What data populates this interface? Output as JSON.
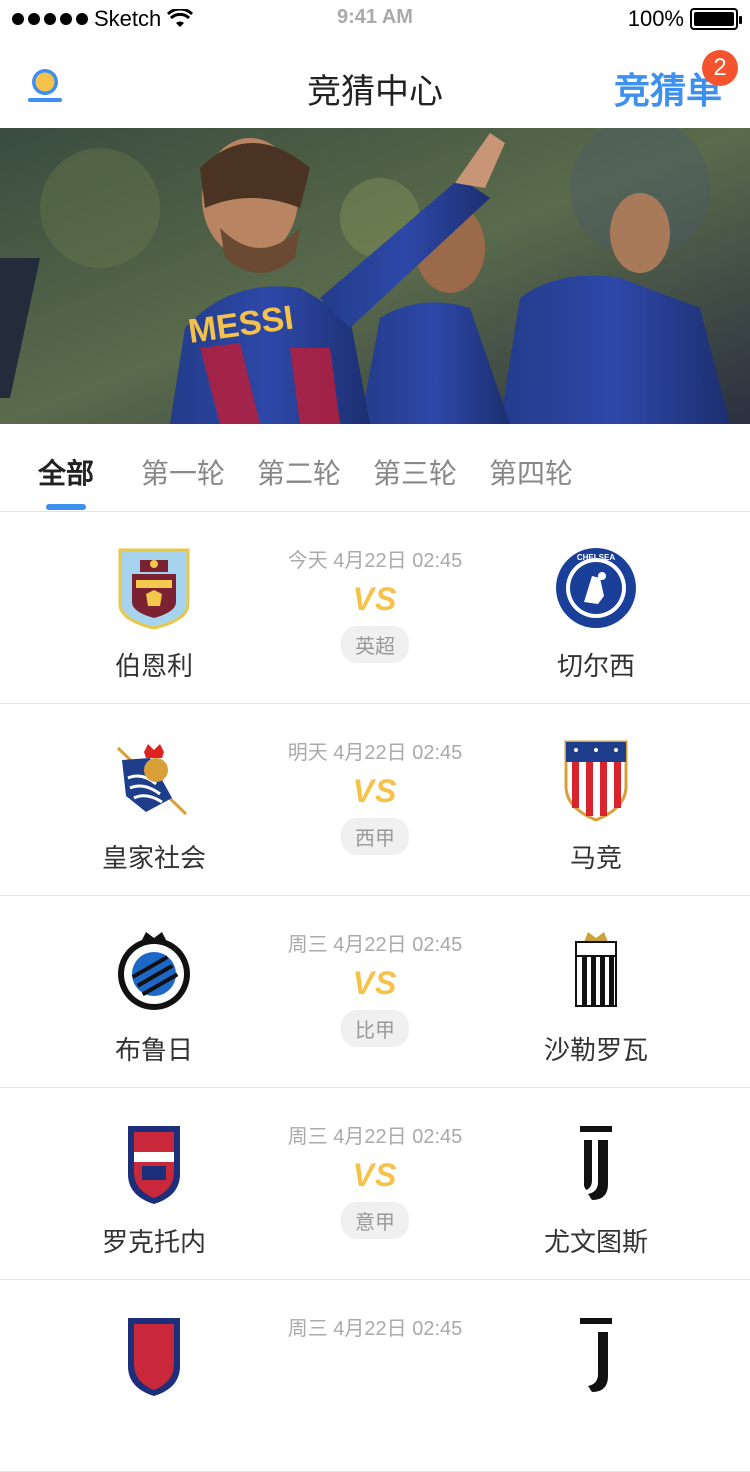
{
  "status_bar": {
    "carrier": "Sketch",
    "time": "9:41 AM",
    "battery": "100%"
  },
  "nav": {
    "title": "竞猜中心",
    "cart_label": "竞猜单",
    "cart_count": "2"
  },
  "tabs": [
    "全部",
    "第一轮",
    "第二轮",
    "第三轮",
    "第四轮"
  ],
  "matches": [
    {
      "home": "伯恩利",
      "away": "切尔西",
      "time": "今天 4月22日 02:45",
      "vs": "VS",
      "league": "英超"
    },
    {
      "home": "皇家社会",
      "away": "马竞",
      "time": "明天 4月22日 02:45",
      "vs": "VS",
      "league": "西甲"
    },
    {
      "home": "布鲁日",
      "away": "沙勒罗瓦",
      "time": "周三 4月22日 02:45",
      "vs": "VS",
      "league": "比甲"
    },
    {
      "home": "罗克托内",
      "away": "尤文图斯",
      "time": "周三 4月22日 02:45",
      "vs": "VS",
      "league": "意甲"
    },
    {
      "home": "",
      "away": "",
      "time": "周三 4月22日 02:45",
      "vs": "",
      "league": ""
    }
  ],
  "colors": {
    "accent": "#3d8ff0",
    "badge": "#f5532d",
    "vs": "#f7c24a"
  }
}
